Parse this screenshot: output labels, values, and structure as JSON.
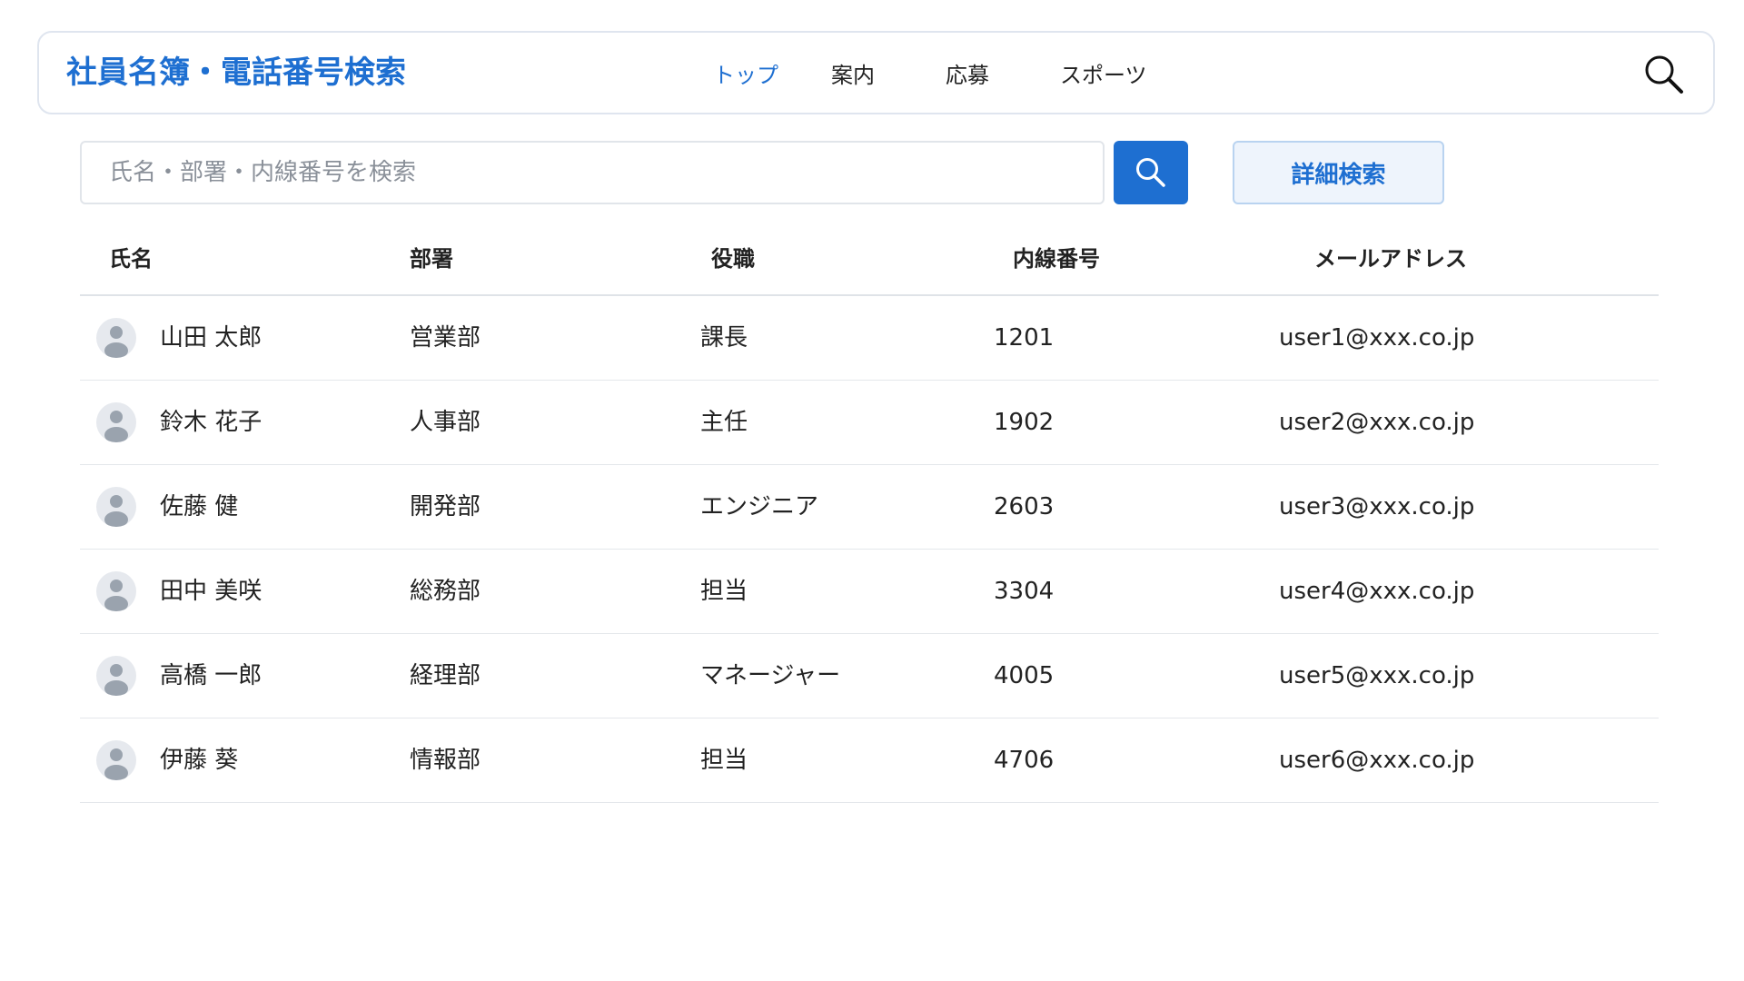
{
  "header": {
    "title": "社員名簿・電話番号検索",
    "nav": [
      {
        "label": "トップ",
        "active": true
      },
      {
        "label": "案内",
        "active": false
      },
      {
        "label": "応募",
        "active": false
      },
      {
        "label": "スポーツ",
        "active": false
      }
    ],
    "search_icon": "search-icon"
  },
  "search": {
    "placeholder": "氏名・部署・内線番号を検索",
    "value": "",
    "button_icon": "search-icon",
    "advanced_label": "詳細検索"
  },
  "table": {
    "columns": [
      "氏名",
      "部署",
      "役職",
      "内線番号",
      "メールアドレス"
    ],
    "rows": [
      {
        "name": "山田 太郎",
        "dept": "営業部",
        "role": "課長",
        "ext": "1201",
        "email": "user1@xxx.co.jp"
      },
      {
        "name": "鈴木 花子",
        "dept": "人事部",
        "role": "主任",
        "ext": "1902",
        "email": "user2@xxx.co.jp"
      },
      {
        "name": "佐藤 健",
        "dept": "開発部",
        "role": "エンジニア",
        "ext": "2603",
        "email": "user3@xxx.co.jp"
      },
      {
        "name": "田中 美咲",
        "dept": "総務部",
        "role": "担当",
        "ext": "3304",
        "email": "user4@xxx.co.jp"
      },
      {
        "name": "高橋 一郎",
        "dept": "経理部",
        "role": "マネージャー",
        "ext": "4005",
        "email": "user5@xxx.co.jp"
      },
      {
        "name": "伊藤 葵",
        "dept": "情報部",
        "role": "担当",
        "ext": "4706",
        "email": "user6@xxx.co.jp"
      }
    ]
  },
  "colors": {
    "accent": "#1e6fd1",
    "avatar_bg": "#e6e9ee",
    "avatar_fg": "#9aa3ae"
  }
}
